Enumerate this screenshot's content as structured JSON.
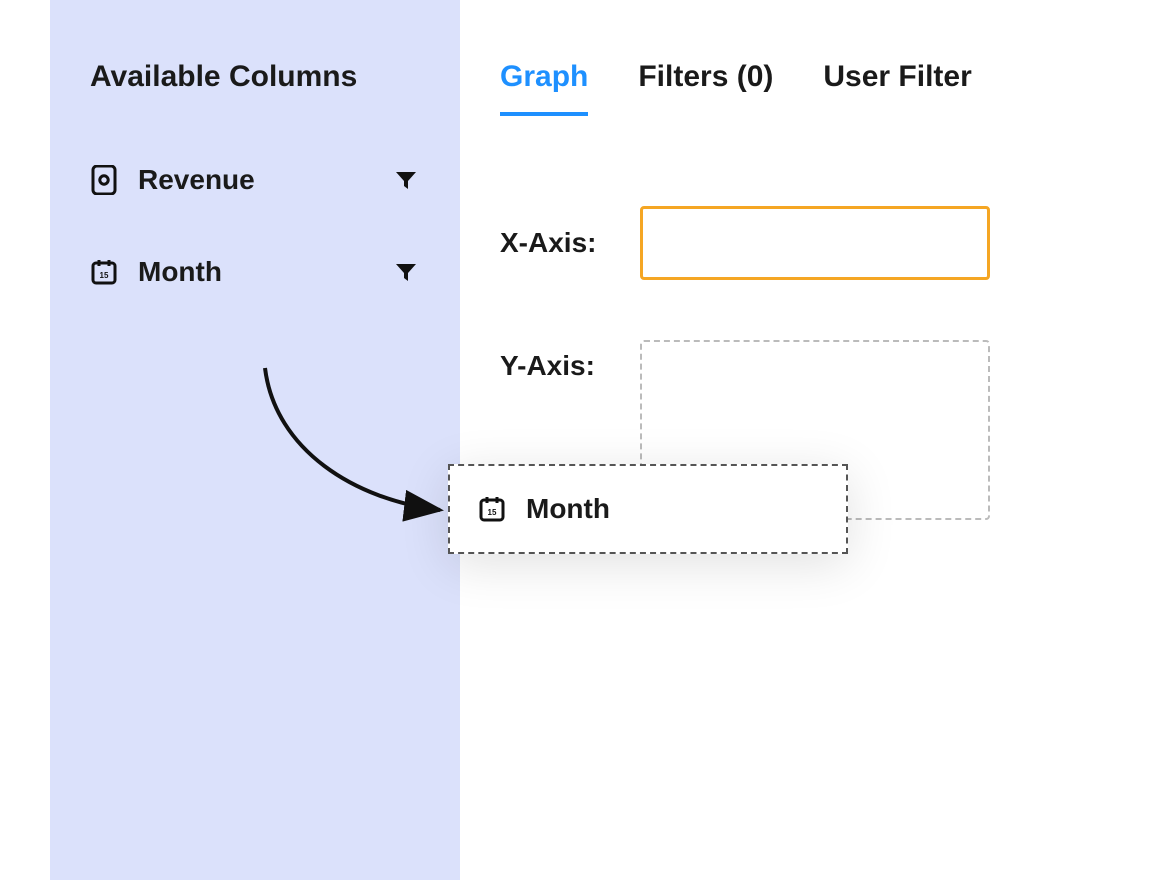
{
  "sidebar": {
    "title": "Available Columns",
    "columns": [
      {
        "label": "Revenue",
        "icon": "money-icon",
        "filter": true
      },
      {
        "label": "Month",
        "icon": "calendar-icon",
        "filter": true
      }
    ]
  },
  "tabs": {
    "items": [
      {
        "label": "Graph",
        "active": true
      },
      {
        "label": "Filters (0)",
        "active": false
      },
      {
        "label": "User Filter",
        "active": false
      }
    ]
  },
  "graph_config": {
    "x_axis_label": "X-Axis:",
    "y_axis_label": "Y-Axis:"
  },
  "drag_preview": {
    "label": "Month",
    "icon": "calendar-icon"
  },
  "colors": {
    "sidebar_bg": "#dbe1fb",
    "tab_active": "#1e90ff",
    "x_dropzone_border": "#f5a623"
  }
}
